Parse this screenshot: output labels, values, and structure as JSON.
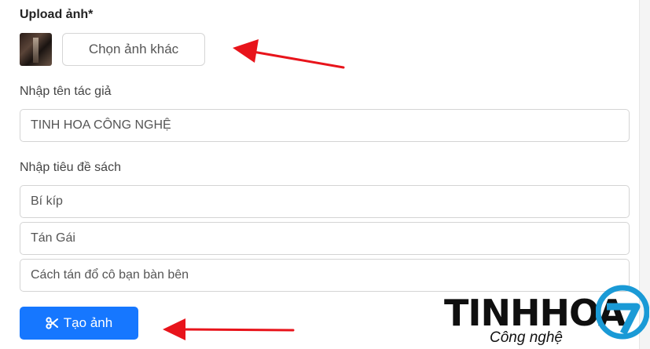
{
  "upload": {
    "label": "Upload ảnh*",
    "choose_button": "Chọn ảnh khác"
  },
  "author": {
    "label": "Nhập tên tác giả",
    "value": "TINH HOA CÔNG NGHỆ"
  },
  "title": {
    "label": "Nhập tiêu đề sách",
    "lines": [
      "Bí kíp",
      "Tán Gái",
      "Cách tán đổ cô bạn bàn bên"
    ]
  },
  "create_button": {
    "icon": "scissors-icon",
    "label": "Tạo ảnh"
  },
  "watermark": {
    "brand": "TINHHOA",
    "tagline": "Công nghệ",
    "badge": "7"
  },
  "colors": {
    "accent": "#1677ff",
    "arrow": "#e8141b",
    "badge": "#1a9ad6"
  }
}
